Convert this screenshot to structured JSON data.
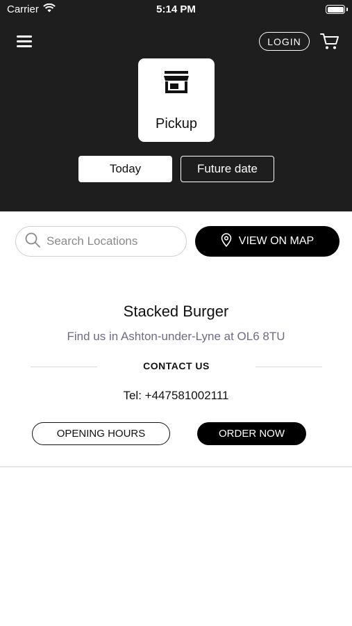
{
  "status_bar": {
    "carrier": "Carrier",
    "time": "5:14 PM"
  },
  "header": {
    "login_label": "LOGIN",
    "pickup_label": "Pickup",
    "today_label": "Today",
    "future_label": "Future date"
  },
  "search": {
    "placeholder": "Search Locations",
    "value": ""
  },
  "map_button": {
    "label": "VIEW ON MAP"
  },
  "store": {
    "name": "Stacked Burger",
    "address": "Find us in Ashton-under-Lyne at OL6 8TU",
    "contact_title": "CONTACT US",
    "tel": "Tel: +447581002111",
    "hours_label": "OPENING HOURS",
    "order_label": "ORDER NOW"
  },
  "icons": {
    "menu": "hamburger-menu-icon",
    "cart": "cart-icon",
    "store": "storefront-icon",
    "search": "search-icon",
    "pin": "location-pin-icon",
    "wifi": "wifi-icon",
    "battery": "battery-icon"
  },
  "colors": {
    "header_bg": "#1e1e1e",
    "accent": "#000000",
    "address_text": "#6f6b84"
  }
}
